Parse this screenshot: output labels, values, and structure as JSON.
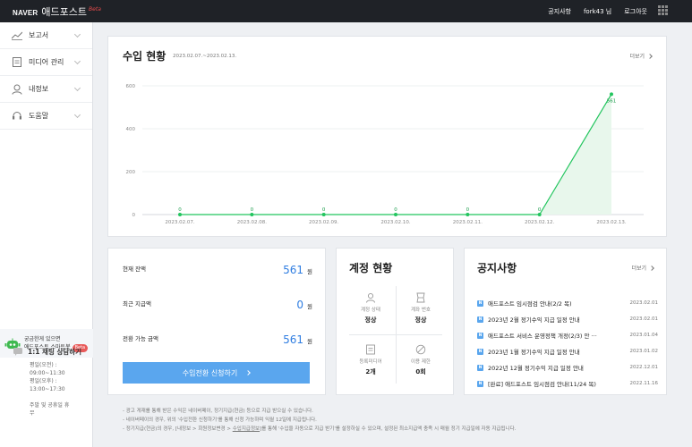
{
  "header": {
    "logo_naver": "NAVER",
    "logo_brand": "애드포스트",
    "logo_beta": "Beta",
    "nav": [
      "공지사항",
      "fork43 님",
      "로그아웃"
    ]
  },
  "sidebar": {
    "items": [
      {
        "label": "보고서",
        "icon": "chart-line-icon"
      },
      {
        "label": "미디어 관리",
        "icon": "document-icon"
      },
      {
        "label": "내정보",
        "icon": "user-icon"
      },
      {
        "label": "도움말",
        "icon": "headset-icon"
      }
    ],
    "chatbot": {
      "line1": "궁금한게 있으면",
      "line2": "애드포스트 스마트봇",
      "badge": "Beta"
    },
    "consult": {
      "title": "1:1 채팅 상담하기",
      "lines": [
        "평일(오전) :",
        "09:00~11:30",
        "평일(오후) :",
        "13:00~17:30",
        "",
        "주말 및 공휴일 휴",
        "무"
      ]
    }
  },
  "income": {
    "title": "수입 현황",
    "date_range": "2023.02.07.~2023.02.13.",
    "more": "더보기"
  },
  "chart_data": {
    "type": "area",
    "categories": [
      "2023.02.07.",
      "2023.02.08.",
      "2023.02.09.",
      "2023.02.10.",
      "2023.02.11.",
      "2023.02.12.",
      "2023.02.13."
    ],
    "values": [
      0,
      0,
      0,
      0,
      0,
      0,
      561
    ],
    "yticks": [
      0,
      200,
      400,
      600
    ],
    "ylim": [
      0,
      600
    ],
    "color": "#22c55e",
    "grid": true
  },
  "balance": {
    "rows": [
      {
        "label": "현재 잔액",
        "value": "561",
        "unit": "원"
      },
      {
        "label": "최근 지급액",
        "value": "0",
        "unit": "원"
      },
      {
        "label": "전환 가능 금액",
        "value": "561",
        "unit": "원"
      }
    ],
    "button": "수입전환 신청하기"
  },
  "account": {
    "title": "계정 현황",
    "cells": [
      {
        "label": "계정 상태",
        "value": "정상",
        "icon": "person-icon"
      },
      {
        "label": "계좌 번호",
        "value": "정상",
        "icon": "card-icon"
      },
      {
        "label": "등록미디어",
        "value": "2개",
        "icon": "media-icon"
      },
      {
        "label": "이용 제한",
        "value": "0회",
        "icon": "block-icon"
      }
    ]
  },
  "notice": {
    "title": "공지사항",
    "more": "더보기",
    "items": [
      {
        "title": "애드포스트 임시점검 안내(2/2 목)",
        "date": "2023.02.01"
      },
      {
        "title": "2023년 2월 정기수익 지급 일정 안내",
        "date": "2023.02.01"
      },
      {
        "title": "애드포스트 서비스 운영정책 개정(2/3) 안 ···",
        "date": "2023.01.04"
      },
      {
        "title": "2023년 1월 정기수익 지급 일정 안내",
        "date": "2023.01.02"
      },
      {
        "title": "2022년 12월 정기수익 지급 일정 안내",
        "date": "2022.12.01"
      },
      {
        "title": "[완료] 애드포스트 임시점검 안내(11/24 목)",
        "date": "2022.11.16"
      }
    ]
  },
  "footnotes": {
    "line1": "- 광고 게재를 통해 받은 수익은 네이버페이, 정기지급(현금) 등으로 지급 받으실 수 있습니다.",
    "line2": "- 네이버페이의 경우, 위의 '수입전환 신청하기'를 통해 신청 가능하며 익월 12일에 지급됩니다.",
    "line3_pre": "- 정기지급(현금)의 경우, [내정보 > 회원정보변경 > ",
    "line3_link": "수입지급정보",
    "line3_post": "]를 통해 '수입을 자동으로 지급 받기'를 설정하실 수 있으며, 설정된 최소지급액 충족 시 매월 정기 지급일에 자동 지급됩니다."
  }
}
